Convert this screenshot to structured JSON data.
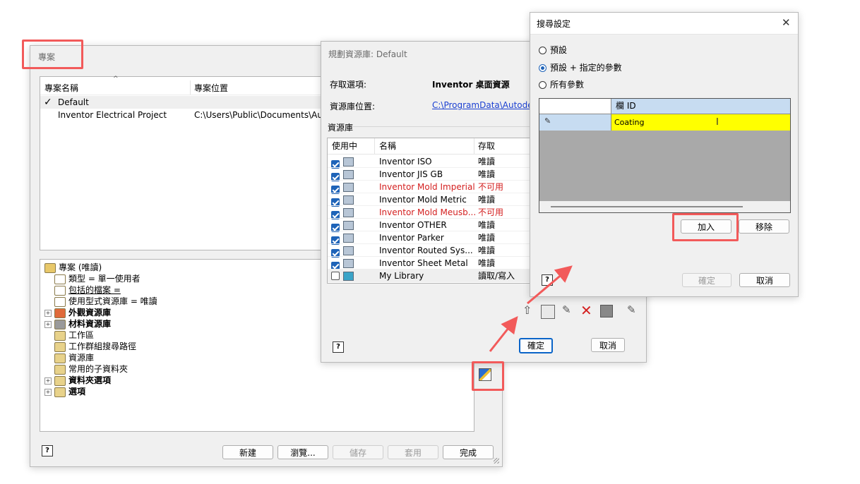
{
  "projects": {
    "title": "專案",
    "columns": [
      "專案名稱",
      "專案位置"
    ],
    "rows": [
      {
        "check": "✓",
        "name": "Default",
        "location": ""
      },
      {
        "check": "",
        "name": "Inventor Electrical Project",
        "location": "C:\\Users\\Public\\Documents\\Auto"
      }
    ],
    "tree": [
      {
        "label": "專案 (唯讀)",
        "indent": 0,
        "bold": false,
        "expander": ""
      },
      {
        "label": "類型 = 單一使用者",
        "indent": 1,
        "bold": false,
        "expander": ""
      },
      {
        "label": "包括的檔案 =",
        "indent": 1,
        "bold": false,
        "expander": ""
      },
      {
        "label": "使用型式資源庫 = 唯讀",
        "indent": 1,
        "bold": false,
        "expander": ""
      },
      {
        "label": "外觀資源庫",
        "indent": 0,
        "bold": true,
        "expander": "+"
      },
      {
        "label": "材料資源庫",
        "indent": 0,
        "bold": true,
        "expander": "+"
      },
      {
        "label": "工作區",
        "indent": 1,
        "bold": false,
        "expander": ""
      },
      {
        "label": "工作群組搜尋路徑",
        "indent": 1,
        "bold": false,
        "expander": ""
      },
      {
        "label": "資源庫",
        "indent": 1,
        "bold": false,
        "expander": ""
      },
      {
        "label": "常用的子資料夾",
        "indent": 1,
        "bold": false,
        "expander": ""
      },
      {
        "label": "資料夾選項",
        "indent": 0,
        "bold": true,
        "expander": "+"
      },
      {
        "label": "選項",
        "indent": 0,
        "bold": true,
        "expander": "+"
      }
    ],
    "buttons": {
      "new": "新建",
      "browse": "瀏覽...",
      "save": "儲存",
      "apply": "套用",
      "done": "完成"
    }
  },
  "library": {
    "title": "規劃資源庫: Default",
    "access_label": "存取選項:",
    "access_value": "Inventor 桌面資源",
    "location_label": "資源庫位置:",
    "location_value": "C:\\ProgramData\\Autodes",
    "section_label": "資源庫",
    "columns": [
      "使用中",
      "名稱",
      "存取"
    ],
    "rows": [
      {
        "checked": true,
        "name": "Inventor ISO",
        "access": "唯讀",
        "error": false
      },
      {
        "checked": true,
        "name": "Inventor JIS GB",
        "access": "唯讀",
        "error": false
      },
      {
        "checked": true,
        "name": "Inventor Mold Imperial",
        "access": "不可用",
        "error": true
      },
      {
        "checked": true,
        "name": "Inventor Mold Metric",
        "access": "唯讀",
        "error": false
      },
      {
        "checked": true,
        "name": "Inventor Mold Meusb...",
        "access": "不可用",
        "error": true
      },
      {
        "checked": true,
        "name": "Inventor OTHER",
        "access": "唯讀",
        "error": false
      },
      {
        "checked": true,
        "name": "Inventor Parker",
        "access": "唯讀",
        "error": false
      },
      {
        "checked": true,
        "name": "Inventor Routed Sys...",
        "access": "唯讀",
        "error": false
      },
      {
        "checked": true,
        "name": "Inventor Sheet Metal",
        "access": "唯讀",
        "error": false
      },
      {
        "checked": false,
        "name": "My Library",
        "access": "讀取/寫入",
        "error": false
      }
    ],
    "buttons": {
      "ok": "確定",
      "cancel": "取消"
    },
    "error_color": "#d42020",
    "link_color": "#1a3fd1"
  },
  "search": {
    "title": "搜尋設定",
    "options": [
      {
        "label": "預設",
        "selected": false
      },
      {
        "label": "預設 + 指定的參數",
        "selected": true
      },
      {
        "label": "所有參數",
        "selected": false
      }
    ],
    "grid_header": "欄 ID",
    "grid_value": "Coating",
    "buttons": {
      "add": "加入",
      "remove": "移除",
      "ok": "確定",
      "cancel": "取消"
    },
    "highlight_color": "#ffff00"
  },
  "annotation_color": "#f25a5a"
}
